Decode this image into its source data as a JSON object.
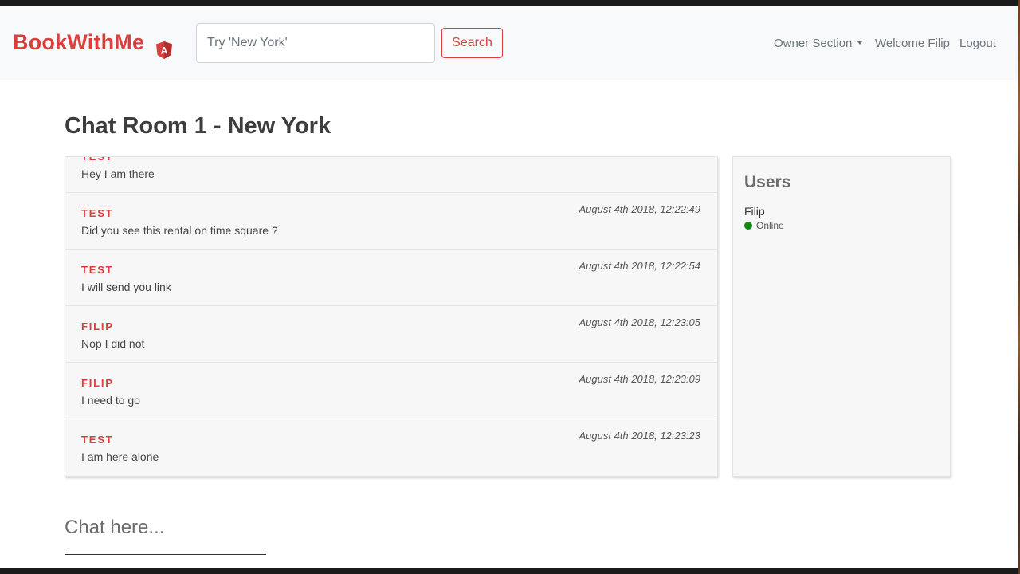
{
  "navbar": {
    "brand": "BookWithMe",
    "brand_badge_letter": "A",
    "search_placeholder": "Try 'New York'",
    "search_button": "Search",
    "owner_section": "Owner Section",
    "welcome": "Welcome Filip",
    "logout": "Logout"
  },
  "page": {
    "title": "Chat Room 1 - New York"
  },
  "messages": [
    {
      "author": "TEST",
      "time": "",
      "text": "Hey I am there"
    },
    {
      "author": "TEST",
      "time": "August 4th 2018, 12:22:49",
      "text": "Did you see this rental on time square ?"
    },
    {
      "author": "TEST",
      "time": "August 4th 2018, 12:22:54",
      "text": "I will send you link"
    },
    {
      "author": "FILIP",
      "time": "August 4th 2018, 12:23:05",
      "text": "Nop I did not"
    },
    {
      "author": "FILIP",
      "time": "August 4th 2018, 12:23:09",
      "text": "I need to go"
    },
    {
      "author": "TEST",
      "time": "August 4th 2018, 12:23:23",
      "text": "I am here alone"
    }
  ],
  "users": {
    "title": "Users",
    "list": [
      {
        "name": "Filip",
        "status": "Online"
      }
    ]
  },
  "chat_input": {
    "placeholder": "Chat here..."
  },
  "colors": {
    "brand": "#dc3d3d",
    "online": "#0f8a0f"
  }
}
